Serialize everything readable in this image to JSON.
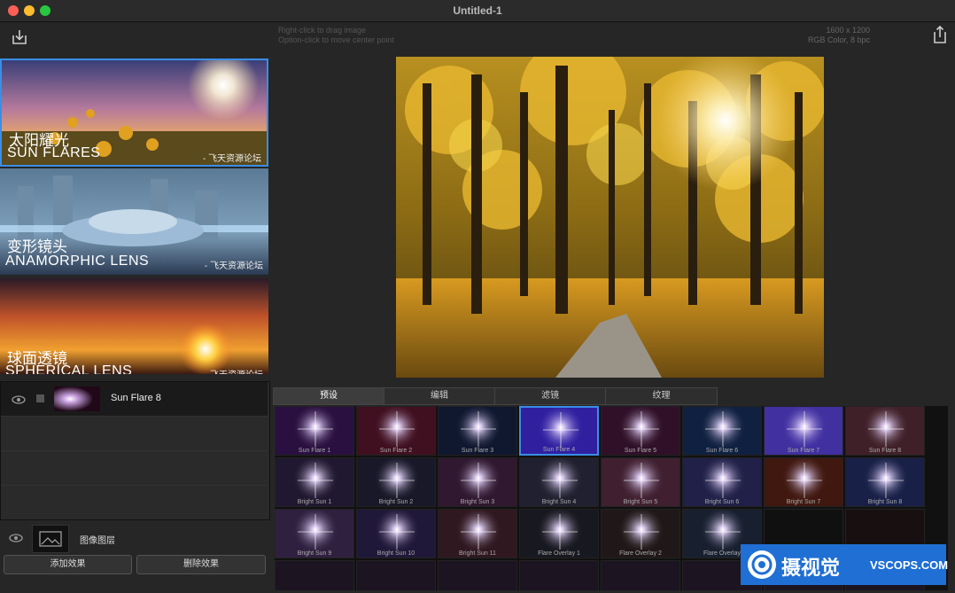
{
  "window": {
    "title": "Untitled-1"
  },
  "toolbar": {
    "hint_line1": "Right-click to drag image",
    "hint_line2": "Option-click to move center point",
    "image_size": "1600 x 1200",
    "image_mode": "RGB Color, 8 bpc",
    "import_icon": "import-icon",
    "share_icon": "share-icon"
  },
  "presets_cards": [
    {
      "cn": "太阳耀光",
      "en": "SUN FLARES",
      "watermark": "- 飞天资源论坛"
    },
    {
      "cn": "变形镜头",
      "en": "ANAMORPHIC LENS",
      "watermark": "- 飞天资源论坛"
    },
    {
      "cn": "球面透镜",
      "en": "SPHERICAL LENS",
      "watermark": "- 飞天资源论坛"
    }
  ],
  "layers": {
    "items": [
      {
        "name": "Sun Flare 8"
      }
    ],
    "image_layer": "图像图层",
    "add_effect": "添加效果",
    "delete_effect": "删除效果"
  },
  "tabs": [
    "预设",
    "编辑",
    "滤镜",
    "纹理"
  ],
  "thumbnails": {
    "row1": [
      "Sun Flare 1",
      "Sun Flare 2",
      "Sun Flare 3",
      "Sun Flare 4",
      "Sun Flare 5",
      "Sun Flare 6",
      "Sun Flare 7",
      "Sun Flare 8"
    ],
    "row2": [
      "Bright Sun 1",
      "Bright Sun 2",
      "Bright Sun 3",
      "Bright Sun 4",
      "Bright Sun 5",
      "Bright Sun 6",
      "Bright Sun 7",
      "Bright Sun 8"
    ],
    "row3": [
      "Bright Sun 9",
      "Bright Sun 10",
      "Bright Sun 11",
      "Flare Overlay 1",
      "Flare Overlay 2",
      "Flare Overlay",
      "",
      ""
    ]
  },
  "badge": {
    "cn": "摄视觉",
    "en": "VSCOPS.COM"
  },
  "colors": {
    "accent": "#3a8ee6",
    "badge_bg": "#1f6fd4"
  }
}
